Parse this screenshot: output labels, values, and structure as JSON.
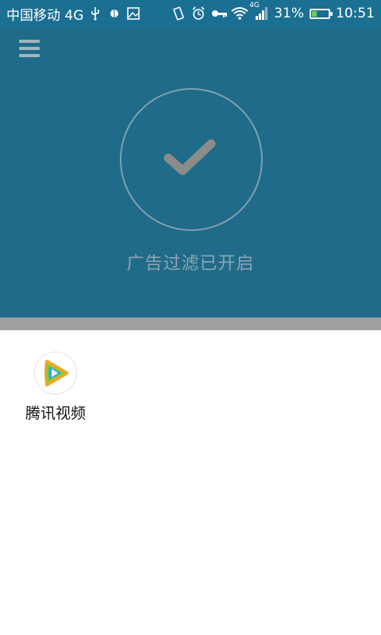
{
  "status_bar": {
    "carrier": "中国移动 4G",
    "battery_percent": "31%",
    "battery_level": 0.31,
    "time": "10:51",
    "network_label": "4G",
    "icons": [
      "usb-icon",
      "android-debug-icon",
      "image-icon",
      "vibrate-icon",
      "alarm-icon",
      "key-icon",
      "wifi-icon",
      "signal-icon",
      "battery-icon"
    ]
  },
  "header": {
    "menu_icon": "hamburger-menu-icon",
    "status_icon": "checkmark-icon",
    "status_text": "广告过滤已开启"
  },
  "apps": [
    {
      "label": "腾讯视频",
      "icon": "tencent-video-icon"
    }
  ],
  "colors": {
    "status_bar": "#1a6f93",
    "hero": "#1f6b89",
    "divider": "#a0a0a0",
    "check": "#8c8c8c"
  }
}
